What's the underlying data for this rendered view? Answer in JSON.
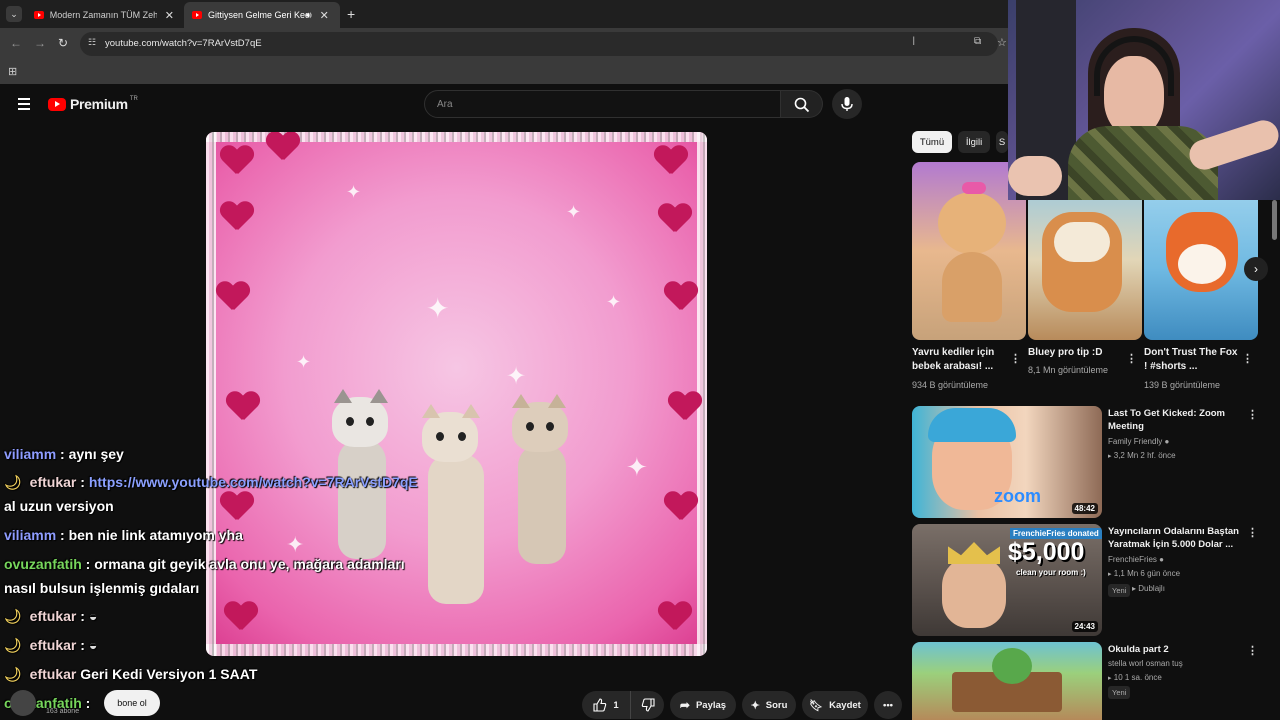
{
  "browser": {
    "tabs": [
      {
        "title": "Modern Zamanın TÜM Zehirleri"
      },
      {
        "title": "Gittiysen Gelme Geri Kedi V"
      }
    ],
    "url": "youtube.com/watch?v=7RArVstD7qE"
  },
  "youtube": {
    "logo_text": "Premium",
    "logo_region": "TR",
    "search_placeholder": "Ara"
  },
  "chat": [
    {
      "user": "viliamm",
      "text": ": aynı şey"
    },
    {
      "user": "eftukar",
      "text": ": ",
      "link": "https://www.youtube.com/watch?v=7RArVstD7qE"
    },
    {
      "user": "",
      "text": "al uzun versiyon"
    },
    {
      "user": "viliamm",
      "text": ": ben nie link atamıyom yha"
    },
    {
      "user": "ovuzanfatih",
      "text": ": ormana git geyik avla onu ye, mağara adamları"
    },
    {
      "user": "",
      "text": "nasıl bulsun işlenmiş gıdaları"
    },
    {
      "user": "eftukar",
      "text": ":"
    },
    {
      "user": "eftukar",
      "text": ":"
    },
    {
      "user": "eftukar",
      "text": "Geri Kedi Versiyon 1 SAAT"
    },
    {
      "user": "ovuzanfatih",
      "text": ":"
    }
  ],
  "video": {
    "subscribe_label": "bone ol",
    "like_count": "1",
    "share_label": "Paylaş",
    "ask_label": "Soru",
    "save_label": "Kaydet",
    "subscriber_text": "163 abone"
  },
  "chips": [
    "Tümü",
    "İlgili",
    "S"
  ],
  "shorts": [
    {
      "title": "Yavru kediler için bebek arabası! ...",
      "views": "934 B görüntüleme"
    },
    {
      "title": "Bluey  pro tip :D",
      "views": "8,1 Mn görüntüleme"
    },
    {
      "title": "Don't Trust The Fox ! #shorts ...",
      "views": "139 B görüntüleme"
    }
  ],
  "recommended": [
    {
      "title": "Last To Get Kicked: Zoom Meeting",
      "channel": "Family Friendly",
      "meta": "3,2 Mn  2 hf. önce",
      "duration": "48:42",
      "new": ""
    },
    {
      "title": "Yayıncıların Odalarını Baştan Yaratmak İçin 5.000 Dolar ...",
      "channel": "FrenchieFries",
      "meta": "1,1 Mn  6 gün önce",
      "duration": "24:43",
      "new": "Yeni",
      "tag": "Dublajlı",
      "overlay_donated": "FrenchieFries donated",
      "overlay_amount": "$5,000",
      "overlay_sub": "clean your room :)"
    },
    {
      "title": "Okulda part 2",
      "channel": "stella worl osman tuş",
      "meta": "10  1 sa. önce",
      "duration": "",
      "new": "Yeni"
    }
  ],
  "thumb_text": {
    "zoom": "zoom"
  }
}
